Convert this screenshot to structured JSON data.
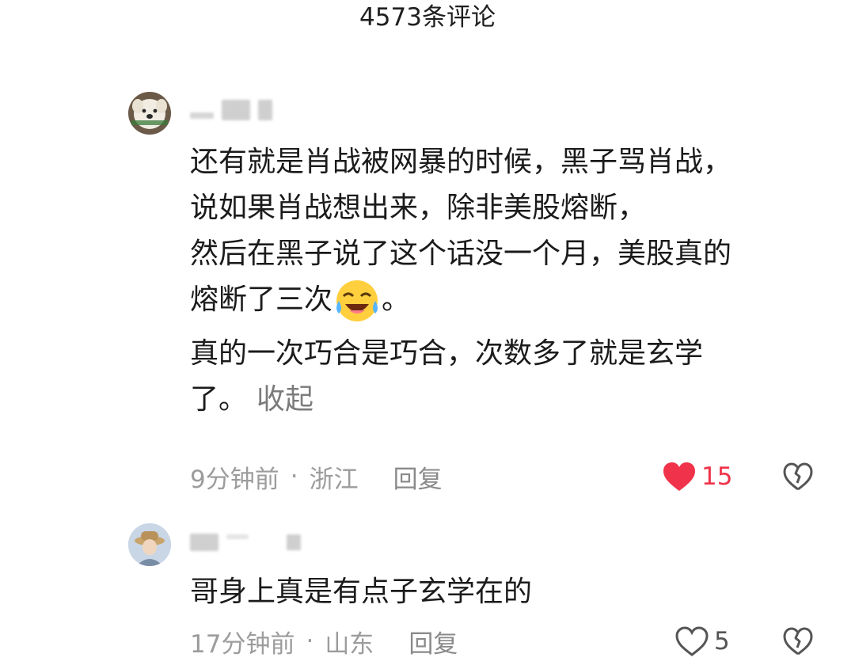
{
  "header": {
    "title": "4573条评论"
  },
  "comments": [
    {
      "lines": [
        "还有就是肖战被网暴的时候，黑子骂肖战，",
        "说如果肖战想出来，除非美股熔断，",
        "然后在黑子说了这个话没一个月，美股真的",
        "熔断了三次",
        "真的一次巧合是巧合，次数多了就是玄学",
        "了。"
      ],
      "emoji_suffix": "。",
      "emoji_name": "laugh-cry-emoji",
      "collapse_label": "收起",
      "time": "9分钟前",
      "location": "浙江",
      "reply_label": "回复",
      "like_count": "15",
      "liked": true
    },
    {
      "lines": [
        "哥身上真是有点子玄学在的"
      ],
      "time": "17分钟前",
      "location": "山东",
      "reply_label": "回复",
      "like_count": "5",
      "liked": false
    }
  ],
  "colors": {
    "like_active": "#f0334a",
    "meta_text": "#9c9c9c",
    "icon_outline": "#555555"
  }
}
